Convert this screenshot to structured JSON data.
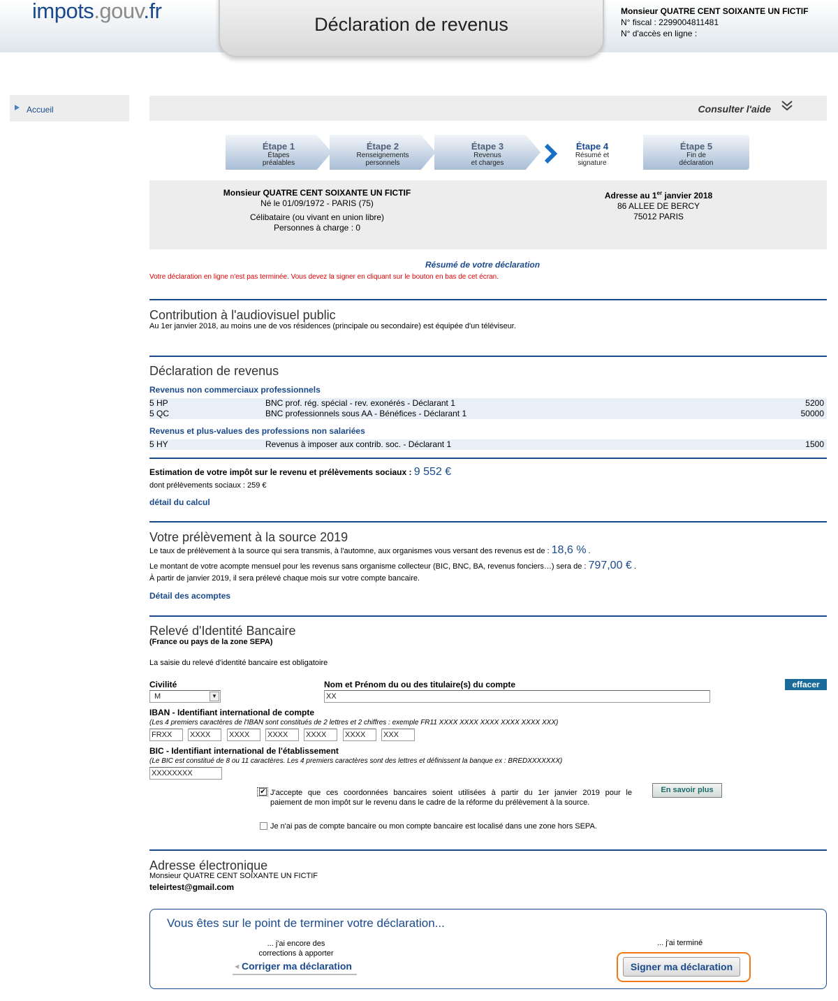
{
  "header": {
    "logo_main": "impots",
    "logo_dot": ".gouv",
    "logo_ext": ".fr",
    "title": "Déclaration de revenus",
    "user_name": "Monsieur QUATRE CENT SOIXANTE UN FICTIF",
    "fiscal_number": "N° fiscal : 2299004811481",
    "access_number": "N° d'accès en ligne :"
  },
  "sidebar": {
    "home": "Accueil"
  },
  "help": {
    "label": "Consulter l'aide"
  },
  "steps": [
    {
      "num": "Étape 1",
      "l1": "Étapes",
      "l2": "préalables"
    },
    {
      "num": "Étape 2",
      "l1": "Renseignements",
      "l2": "personnels"
    },
    {
      "num": "Étape 3",
      "l1": "Revenus",
      "l2": "et charges"
    },
    {
      "num": "Étape 4",
      "l1": "Résumé et",
      "l2": "signature"
    },
    {
      "num": "Étape 5",
      "l1": "Fin de",
      "l2": "déclaration"
    }
  ],
  "info": {
    "name": "Monsieur QUATRE CENT SOIXANTE UN FICTIF",
    "birth": "Né le 01/09/1972 - PARIS (75)",
    "status": "Célibataire (ou vivant en union libre)",
    "dependents": "Personnes à charge : 0",
    "address_title_a": "Adresse au 1",
    "address_title_sup": "er",
    "address_title_b": " janvier 2018",
    "address_line1": "86 ALLEE DE BERCY",
    "address_line2": "75012 PARIS"
  },
  "summary": {
    "title": "Résumé de votre déclaration",
    "warning": "Votre déclaration en ligne n'est pas terminée. Vous devez la signer en cliquant sur le bouton en bas de cet écran."
  },
  "audiovisual": {
    "title": "Contribution à l'audiovisuel public",
    "text": "Au 1er janvier 2018, au moins une de vos résidences (principale ou secondaire) est équipée d'un téléviseur."
  },
  "income": {
    "title": "Déclaration de revenus",
    "group1": "Revenus non commerciaux professionnels",
    "rows1": [
      {
        "code": "5 HP",
        "label": "BNC prof. rég. spécial - rev. exonérés - Déclarant 1",
        "value": "5200"
      },
      {
        "code": "5 QC",
        "label": "BNC professionnels sous AA - Bénéfices - Déclarant 1",
        "value": "50000"
      }
    ],
    "group2": "Revenus et plus-values des professions non salariées",
    "rows2": [
      {
        "code": "5 HY",
        "label": "Revenus à imposer aux contrib. soc. - Déclarant 1",
        "value": "1500"
      }
    ]
  },
  "estimate": {
    "label": "Estimation de votre impôt sur le revenu et prélèvements sociaux :",
    "amount": "9 552 €",
    "social": "dont prélèvements sociaux : 259 €",
    "detail_link": "détail du calcul"
  },
  "withholding": {
    "title": "Votre prélèvement à la source 2019",
    "rate_text": "Le taux de prélèvement à la source qui sera transmis, à l'automne, aux organismes vous versant des revenus est de :",
    "rate": "18,6 %",
    "installment_text": "Le montant de votre acompte mensuel pour les revenus sans organisme collecteur (BIC, BNC, BA, revenus fonciers…) sera de :",
    "installment": "797,00 €",
    "monthly_text": "À partir de janvier 2019, il sera prélevé chaque mois sur votre compte bancaire.",
    "detail_link": "Détail des acomptes"
  },
  "rib": {
    "title": "Relevé d'Identité Bancaire",
    "subtitle": "(France ou pays de la zone SEPA)",
    "mandatory": "La saisie du relevé d'identité bancaire est obligatoire",
    "civility_label": "Civilité",
    "civility_value": "M",
    "holder_label": "Nom et Prénom du ou des titulaire(s) du compte",
    "holder_value": "XX",
    "clear_button": "effacer",
    "iban_label": "IBAN - Identifiant international de compte",
    "iban_hint": "(Les 4 premiers caractères de l'IBAN sont constitués de 2 lettres et 2 chiffres : exemple FR11 XXXX XXXX XXXX XXXX XXXX XXX)",
    "iban_parts": [
      "FRXX",
      "XXXX",
      "XXXX",
      "XXXX",
      "XXXX",
      "XXXX",
      "XXX"
    ],
    "bic_label": "BIC - Identifiant international de l'établissement",
    "bic_hint": "(Le BIC est constitué de 8 ou 11 caractères. Les 4 premiers caractères sont des lettres et définissent la banque ex : BREDXXXXXXX)",
    "bic_value": "XXXXXXXX",
    "accept_line1": "J'accepte que ces coordonnées bancaires soient utilisées à partir du 1er janvier 2019 pour le",
    "accept_line2": "paiement de mon impôt sur le revenu dans le cadre de la réforme du prélèvement à la source.",
    "accept_checked": true,
    "learn_more": "En savoir plus",
    "no_account": "Je n'ai pas de compte bancaire ou mon compte bancaire est localisé dans une zone hors SEPA.",
    "no_account_checked": false
  },
  "email": {
    "title": "Adresse électronique",
    "name": "Monsieur QUATRE CENT SOIXANTE UN FICTIF",
    "address": "teleirtest@gmail.com"
  },
  "finish": {
    "title": "Vous êtes sur le point de terminer votre déclaration...",
    "left_line1": "... j'ai encore des",
    "left_line2": "corrections à apporter",
    "correct_button": "Corriger ma déclaration",
    "right_text": "... j'ai terminé",
    "sign_button": "Signer ma déclaration"
  },
  "colors": {
    "brand": "#1a4a8c",
    "warning": "#e00000",
    "highlight": "#f07a18"
  }
}
